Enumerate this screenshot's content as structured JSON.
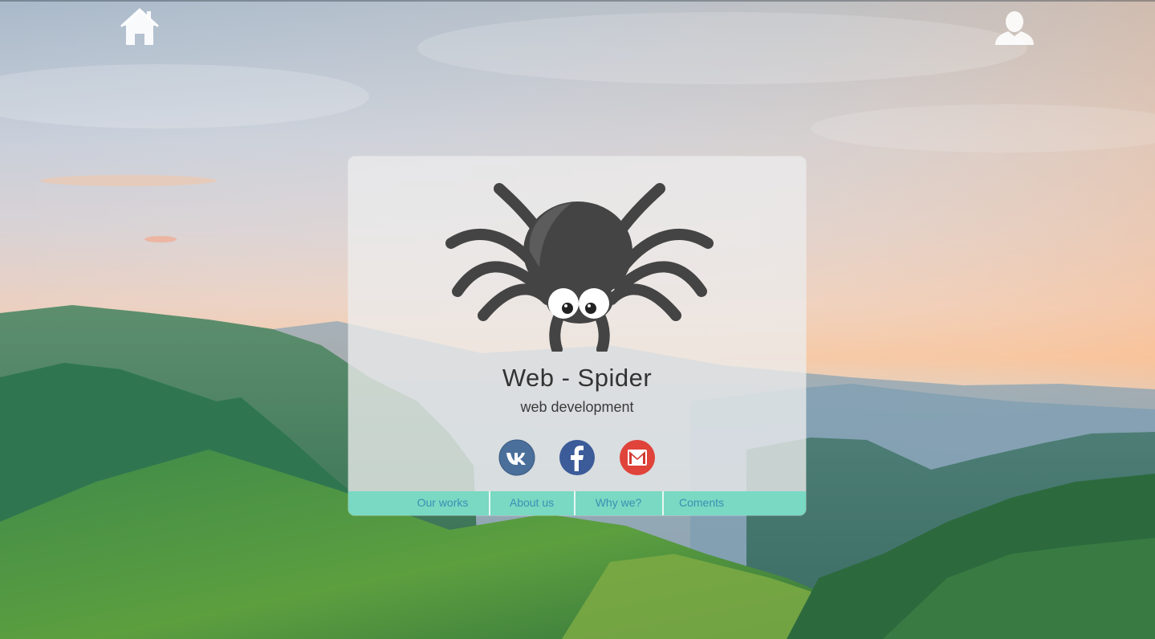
{
  "icons": {
    "home": "home-icon",
    "user": "user-icon",
    "logo": "spider-icon",
    "social": [
      "vk-icon",
      "facebook-icon",
      "gmail-icon"
    ]
  },
  "brand": {
    "title": "Web - Spider",
    "subtitle": "web development"
  },
  "menu": {
    "items": [
      {
        "label": "Our works"
      },
      {
        "label": "About us"
      },
      {
        "label": "Why we?"
      },
      {
        "label": "Coments"
      }
    ]
  },
  "colors": {
    "menu_bg": "#79d9c3",
    "menu_text": "#3b8fb3",
    "vk": "#4a6f9a",
    "facebook": "#3b5b99",
    "gmail": "#e0433a",
    "spider": "#444444"
  }
}
